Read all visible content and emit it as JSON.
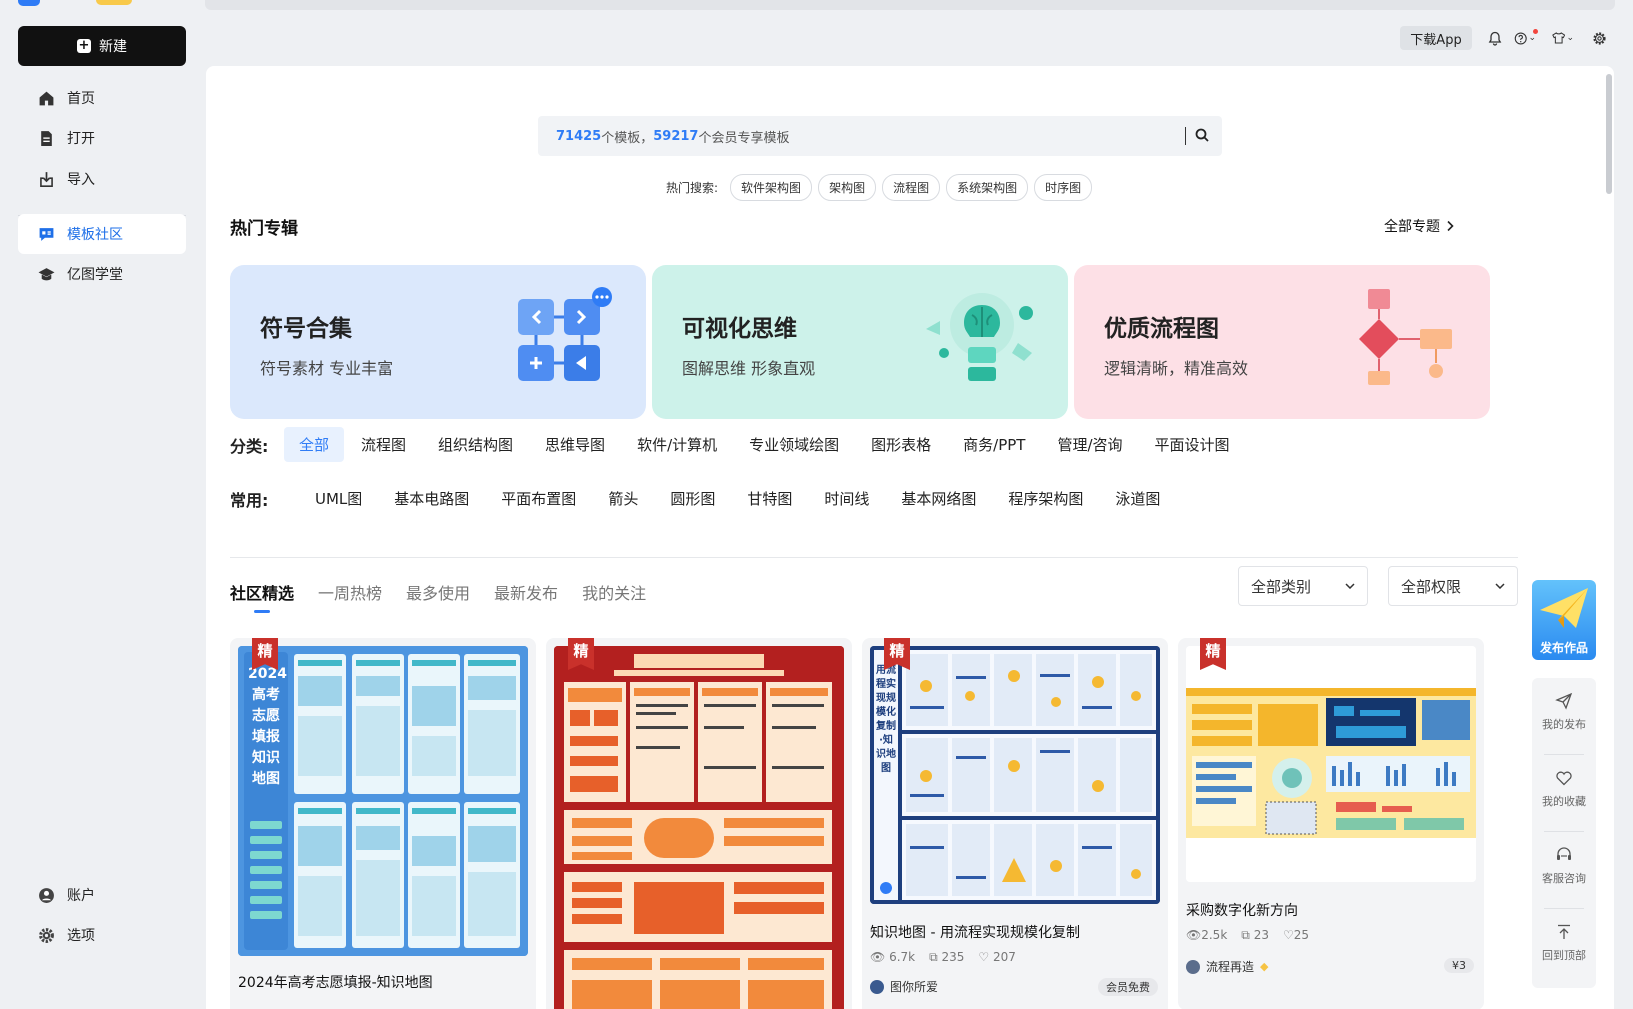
{
  "sidebar": {
    "new_label": "新建",
    "items": [
      {
        "label": "首页"
      },
      {
        "label": "打开"
      },
      {
        "label": "导入"
      },
      {
        "label": "模板社区"
      },
      {
        "label": "亿图学堂"
      }
    ],
    "bottom": [
      {
        "label": "账户"
      },
      {
        "label": "选项"
      }
    ]
  },
  "header": {
    "download_label": "下载App",
    "icons": [
      "bell-icon",
      "help-icon",
      "shirt-icon",
      "gear-icon"
    ]
  },
  "search": {
    "templates_count": "71425",
    "templates_text": "个模板，",
    "member_count": "59217",
    "member_text": "个会员专享模板"
  },
  "hot_search": {
    "label": "热门搜索:",
    "terms": [
      "软件架构图",
      "架构图",
      "流程图",
      "系统架构图",
      "时序图"
    ]
  },
  "featured": {
    "title": "热门专辑",
    "all_label": "全部专题",
    "topics": [
      {
        "title": "符号合集",
        "subtitle": "符号素材 专业丰富",
        "color": "#dbe8fc"
      },
      {
        "title": "可视化思维",
        "subtitle": "图解思维 形象直观",
        "color": "#cdf2ea"
      },
      {
        "title": "优质流程图",
        "subtitle": "逻辑清晰，精准高效",
        "color": "#fde0e6"
      }
    ]
  },
  "categories": {
    "label": "分类:",
    "items": [
      "全部",
      "流程图",
      "组织结构图",
      "思维导图",
      "软件/计算机",
      "专业领域绘图",
      "图形表格",
      "商务/PPT",
      "管理/咨询",
      "平面设计图"
    ]
  },
  "common": {
    "label": "常用:",
    "items": [
      "UML图",
      "基本电路图",
      "平面布置图",
      "箭头",
      "圆形图",
      "甘特图",
      "时间线",
      "基本网络图",
      "程序架构图",
      "泳道图"
    ]
  },
  "tabs": [
    "社区精选",
    "一周热榜",
    "最多使用",
    "最新发布",
    "我的关注"
  ],
  "filters": {
    "category": "全部类别",
    "permission": "全部权限"
  },
  "cards": [
    {
      "badge": "精",
      "title": "2024年高考志愿填报-知识地图",
      "poster_title": "2024高考志愿填报知识地图"
    },
    {
      "badge": "精",
      "title": ""
    },
    {
      "badge": "精",
      "title": "知识地图 - 用流程实现规模化复制",
      "views": "6.7k",
      "copies": "235",
      "likes": "207",
      "author": "图你所爱",
      "price": "会员免费",
      "poster_title": "用流程实现规模化复制·知识地图"
    },
    {
      "badge": "精",
      "title": "采购数字化新方向",
      "views": "2.5k",
      "copies": "23",
      "likes": "25",
      "author": "流程再造",
      "price": "¥3"
    }
  ],
  "float_panel": {
    "publish_label": "发布作品",
    "items": [
      {
        "label": "我的发布"
      },
      {
        "label": "我的收藏"
      },
      {
        "label": "客服咨询"
      },
      {
        "label": "回到顶部"
      }
    ]
  }
}
